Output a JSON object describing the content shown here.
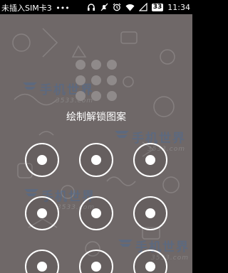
{
  "status_bar": {
    "carrier": "未插入SIM卡3",
    "more": "•••",
    "battery": "33",
    "time": "11:34",
    "icons": [
      "headset-icon",
      "mute-icon",
      "alarm-icon",
      "wifi-icon",
      "signal-icon",
      "battery-icon"
    ]
  },
  "lock_screen": {
    "title": "绘制解锁图案"
  },
  "watermark": {
    "cn": "手机世界",
    "url": "3533.com"
  },
  "colors": {
    "background": "#6f6868",
    "node": "#ffffff"
  }
}
